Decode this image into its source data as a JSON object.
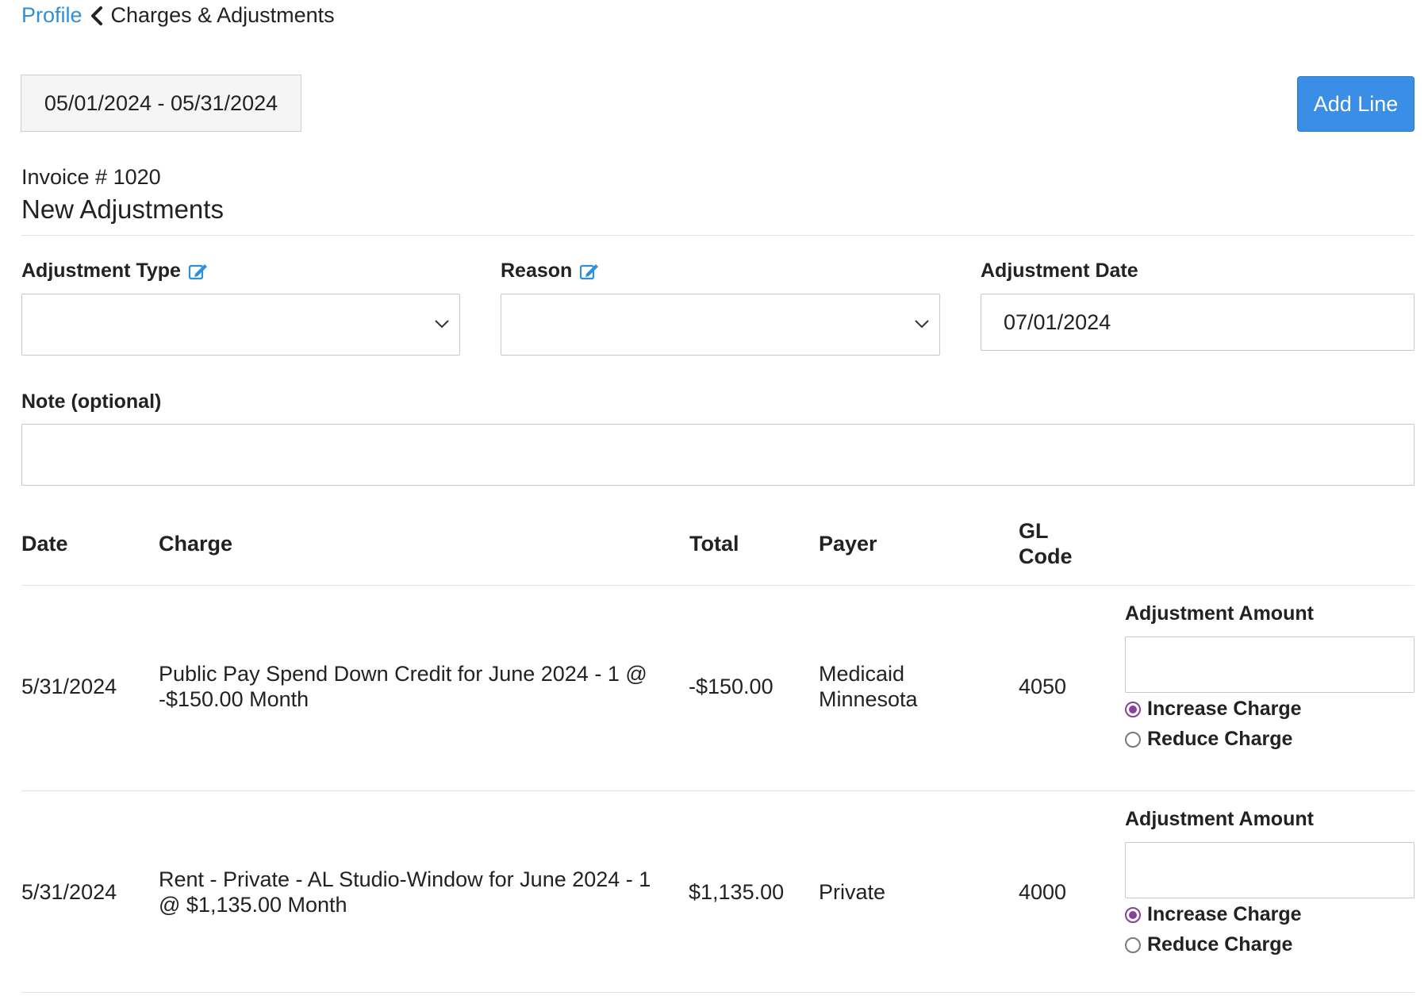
{
  "breadcrumb": {
    "link": "Profile",
    "current": "Charges & Adjustments"
  },
  "date_range": "05/01/2024 - 05/31/2024",
  "add_line_label": "Add Line",
  "invoice_label": "Invoice # 1020",
  "section_title": "New Adjustments",
  "form": {
    "adjustment_type_label": "Adjustment Type",
    "reason_label": "Reason",
    "adjustment_date_label": "Adjustment Date",
    "adjustment_date_value": "07/01/2024",
    "note_label": "Note (optional)"
  },
  "table": {
    "headers": {
      "date": "Date",
      "charge": "Charge",
      "total": "Total",
      "payer": "Payer",
      "gl_line1": "GL",
      "gl_line2": "Code"
    },
    "rows": [
      {
        "date": "5/31/2024",
        "charge_line1": "Public Pay Spend Down Credit for June 2024 - 1 @",
        "charge_line2": "-$150.00 Month",
        "total": "-$150.00",
        "payer_line1": "Medicaid",
        "payer_line2": "Minnesota",
        "gl_code": "4050",
        "adjustment_amount_label": "Adjustment Amount",
        "increase_label": "Increase Charge",
        "reduce_label": "Reduce Charge",
        "selected": "increase"
      },
      {
        "date": "5/31/2024",
        "charge_line1": "Rent - Private - AL Studio-Window for June 2024 - 1",
        "charge_line2": "@ $1,135.00 Month",
        "total": "$1,135.00",
        "payer_line1": "Private",
        "payer_line2": "",
        "gl_code": "4000",
        "adjustment_amount_label": "Adjustment Amount",
        "increase_label": "Increase Charge",
        "reduce_label": "Reduce Charge",
        "selected": "increase"
      }
    ]
  },
  "icons": {
    "back": "chevron-left-icon",
    "edit": "edit-icon",
    "dropdown": "chevron-down-icon"
  },
  "colors": {
    "link": "#2f8fd8",
    "primary_button": "#3a8ee6",
    "radio_selected": "#8a3f9e"
  }
}
